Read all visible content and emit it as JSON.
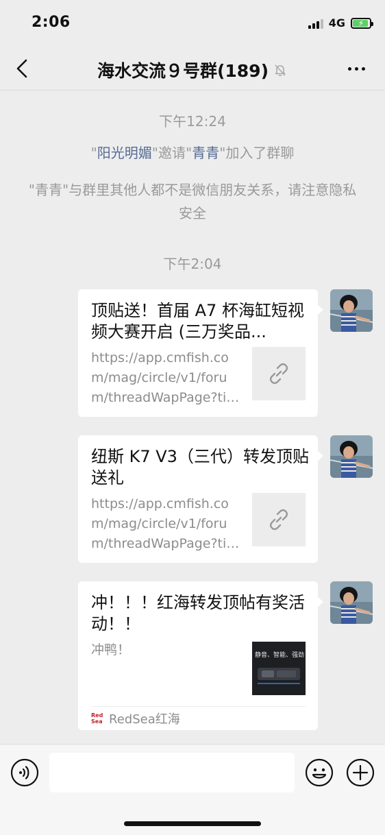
{
  "status_bar": {
    "time": "2:06",
    "network": "4G"
  },
  "header": {
    "title": "海水交流９号群(189)"
  },
  "chat": {
    "timestamp_1": "下午12:24",
    "invite": {
      "q1": "\"",
      "inviter": "阳光明媚",
      "mid": "\"邀请\"",
      "invitee": "青青",
      "end": "\"加入了群聊"
    },
    "privacy_notice": "\"青青\"与群里其他人都不是微信朋友关系，请注意隐私安全",
    "timestamp_2": "下午2:04",
    "messages": [
      {
        "title": "顶贴送！首届 A7 杯海缸短视频大赛开启 (三万奖品...",
        "description": "https://app.cmfish.com/mag/circle/v1/forum/threadWapPage?tid..."
      },
      {
        "title": "纽斯 K7 V3（三代）转发顶贴送礼",
        "description": "https://app.cmfish.com/mag/circle/v1/forum/threadWapPage?tid..."
      },
      {
        "title": "冲！！！红海转发顶帖有奖活动！！",
        "description": "冲鸭！",
        "thumbnail_text": "静音、智能、强劲",
        "source_logo": "Red Sea",
        "source": "RedSea红海"
      }
    ]
  },
  "input_bar": {
    "placeholder": ""
  },
  "colors": {
    "background": "#ededed",
    "link_name": "#576b95",
    "system_text": "#9a9a9a",
    "battery": "#5fd068"
  }
}
